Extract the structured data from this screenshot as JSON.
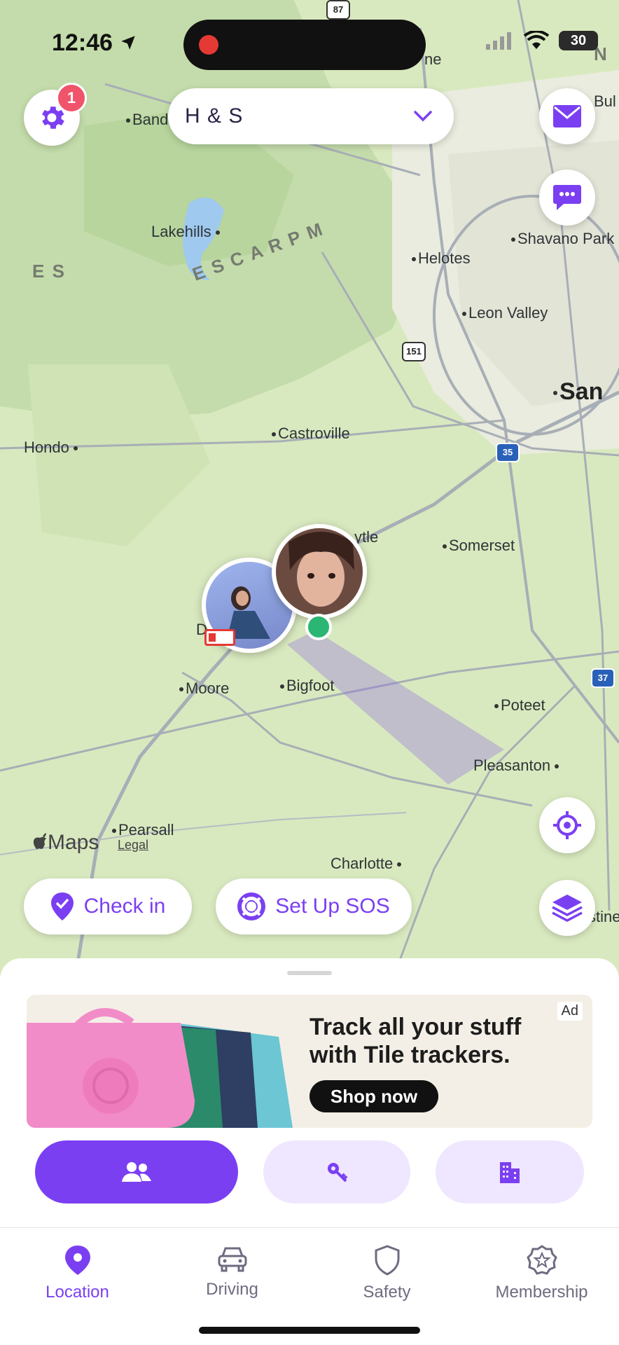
{
  "status_bar": {
    "time": "12:46",
    "battery": "30"
  },
  "header": {
    "circle_name": "H & S",
    "settings_badge": "1"
  },
  "map": {
    "labels": {
      "bandera": "Band",
      "lakehills": "Lakehills",
      "helotes": "Helotes",
      "shavano_park": "Shavano Park",
      "leon_valley": "Leon Valley",
      "san_antonio": "San",
      "hondo": "Hondo",
      "castroville": "Castroville",
      "somerset": "Somerset",
      "lytle": "ytle",
      "devine": "D",
      "moore": "Moore",
      "bigfoot": "Bigfoot",
      "poteet": "Poteet",
      "pleasanton": "Pleasanton",
      "pearsall": "Pearsall",
      "charlotte": "Charlotte",
      "boerne_partial": "ne",
      "bulverde_partial": "Bul",
      "christine_partial": "stine",
      "n_partial": "N"
    },
    "region_text": {
      "escarpment_1": "E S",
      "escarpment_2": "E S C A R P M",
      "edge": "E S"
    },
    "shields": {
      "us87": "87",
      "tx151": "151",
      "i35": "35",
      "i37": "37"
    },
    "attribution": "Maps",
    "legal": "Legal"
  },
  "actions": {
    "check_in": "Check in",
    "sos": "Set Up SOS"
  },
  "ad": {
    "title_line1": "Track all your stuff",
    "title_line2": "with Tile trackers.",
    "cta": "Shop now",
    "tag": "Ad"
  },
  "tabs": [
    {
      "label": "Location"
    },
    {
      "label": "Driving"
    },
    {
      "label": "Safety"
    },
    {
      "label": "Membership"
    }
  ],
  "colors": {
    "accent": "#7b3ff2",
    "accent_light": "#efe6ff",
    "badge": "#f0546a"
  }
}
